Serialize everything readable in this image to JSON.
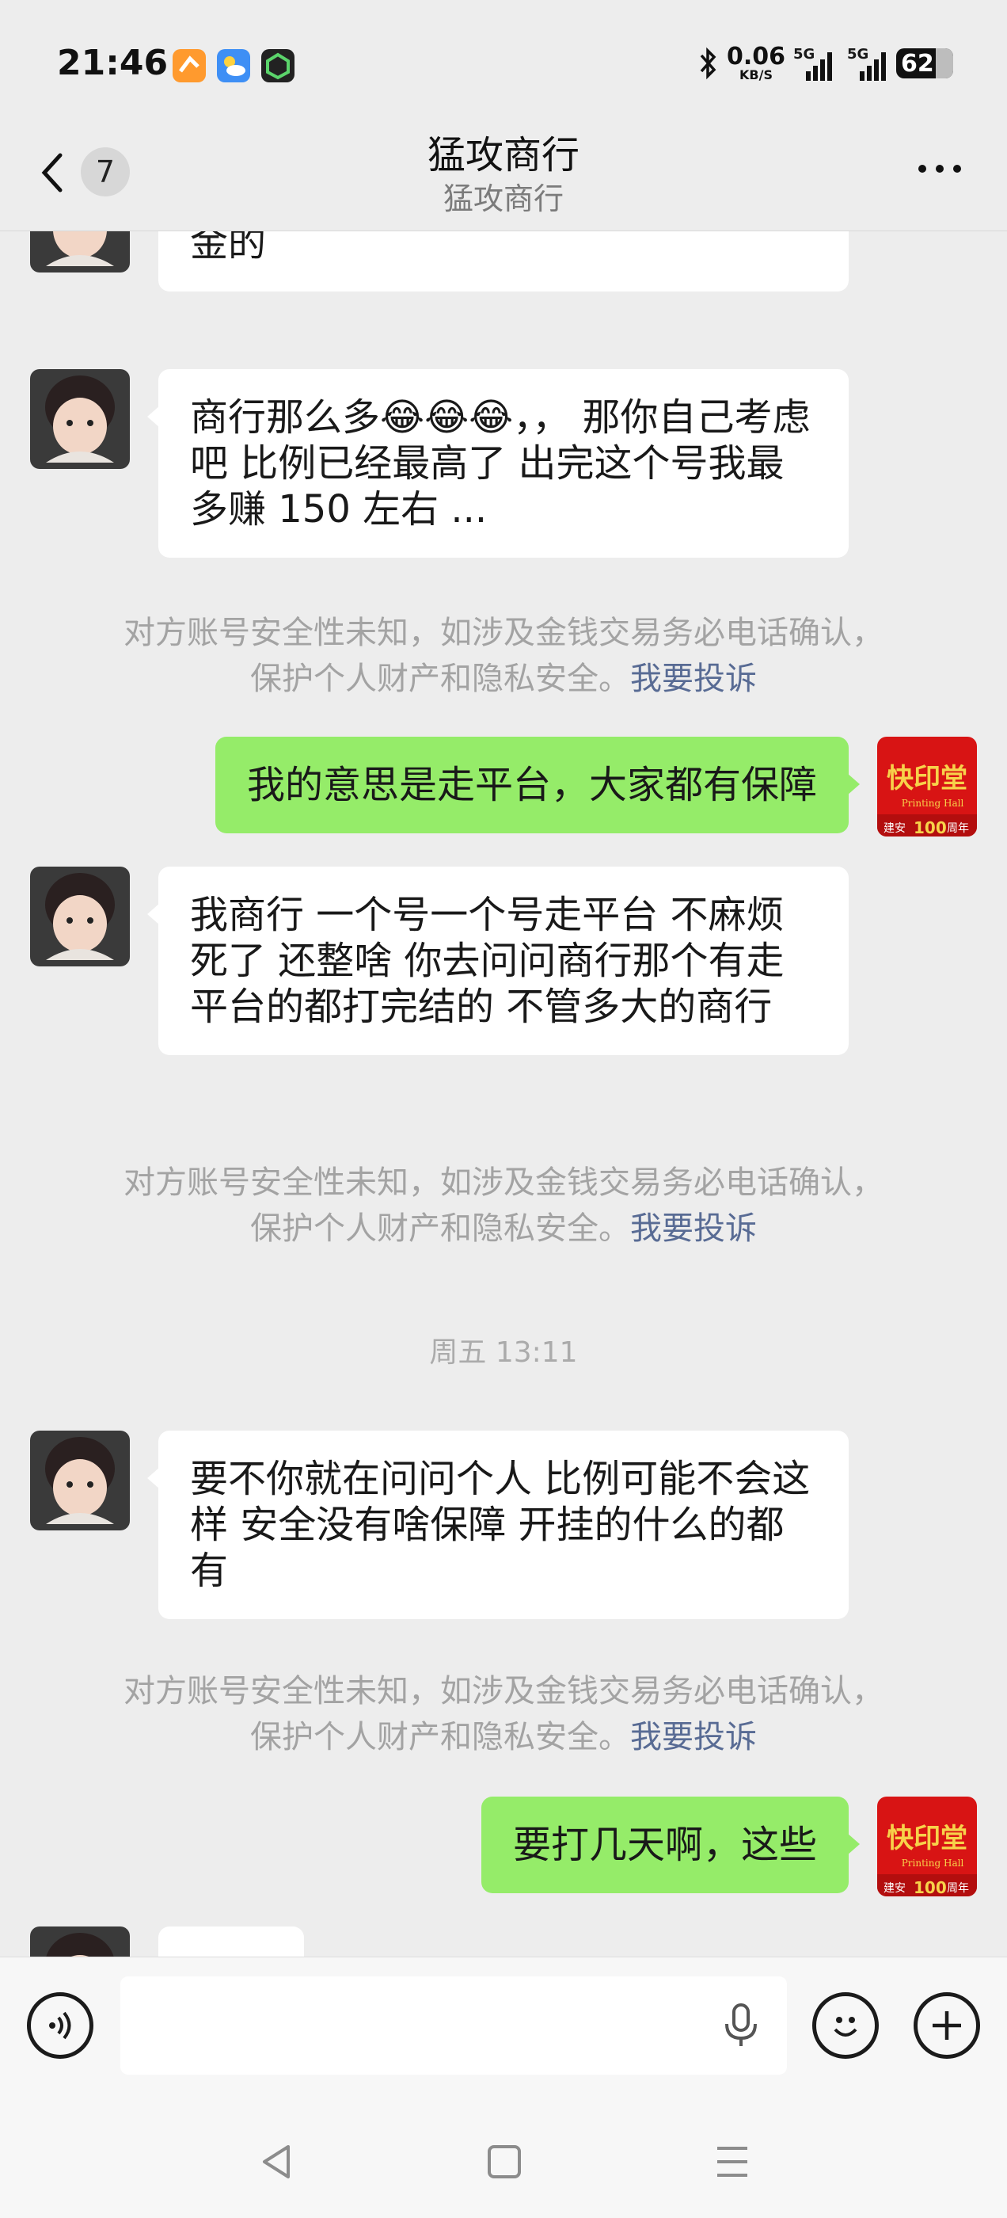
{
  "status_bar": {
    "time": "21:46",
    "net_speed_value": "0.06",
    "net_speed_unit": "KB/S",
    "signal_1_label": "5G",
    "signal_2_label": "5G",
    "battery": "62",
    "icons": [
      "app-orange-icon",
      "weather-icon",
      "app-green-icon",
      "bluetooth-icon",
      "signal-icon",
      "battery-icon"
    ]
  },
  "nav": {
    "unread_count": "7",
    "title": "猛攻商行",
    "subtitle": "猛攻商行"
  },
  "messages": [
    {
      "side": "left",
      "text": "打手都俱乐部合作的都是纯绿 都有押金的"
    },
    {
      "side": "left",
      "text": "商行那么多😂😂😂，， 那你自己考虑吧 比例已经最高了 出完这个号我最多赚 150 左右 ..."
    },
    {
      "side": "right",
      "text": "我的意思是走平台，大家都有保障"
    },
    {
      "side": "left",
      "text": "我商行  一个号一个号走平台 不麻烦死了 还整啥 你去问问商行那个有走平台的都打完结的 不管多大的商行"
    },
    {
      "side": "left",
      "text": "要不你就在问问个人 比例可能不会这样 安全没有啥保障 开挂的什么的都有"
    },
    {
      "side": "right",
      "text": "要打几天啊，这些"
    }
  ],
  "system_notice": {
    "line1": "对方账号安全性未知，如涉及金钱交易务必电话确认，",
    "line2": "保护个人财产和隐私安全。",
    "link": "我要投诉"
  },
  "timestamp": "周五 13:11",
  "sticker": {
    "main": "快印堂",
    "sub": "Printing Hall",
    "badge": "建安",
    "years": "100",
    "years_suffix": "周年"
  },
  "input": {
    "value": "",
    "placeholder": ""
  },
  "colors": {
    "background": "#ededed",
    "outgoing_bubble": "#95ec69",
    "incoming_bubble": "#ffffff",
    "link": "#586b94",
    "notice_text": "#a3a3a3"
  }
}
